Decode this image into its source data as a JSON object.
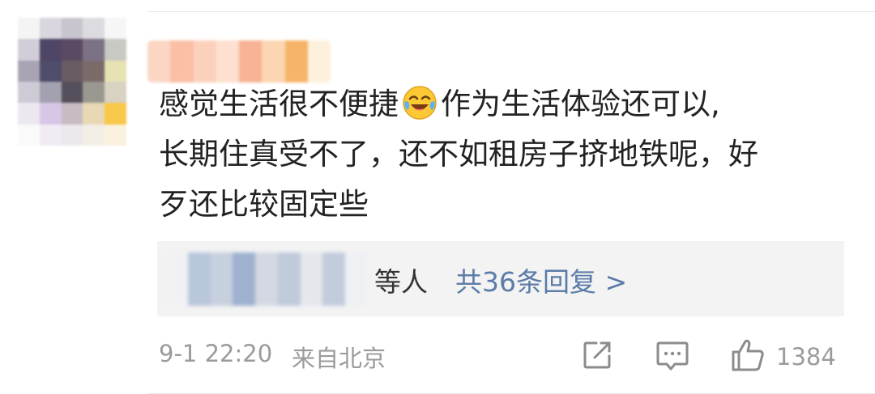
{
  "comment": {
    "line1_before_emoji": "感觉生活很不便捷",
    "emoji": "laughing-crying-face-icon",
    "line1_after_emoji": "作为生活体验还可以,",
    "line2": "长期住真受不了，还不如租房子挤地铁呢，好",
    "line3": "歹还比较固定些"
  },
  "replies": {
    "suffix": "等人",
    "count_label": "共36条回复 >"
  },
  "meta": {
    "time": "9-1 22:20",
    "source": "来自北京",
    "like_count": "1384"
  },
  "icons": {
    "share": "share-icon",
    "comment": "comment-icon",
    "like": "thumbs-up-icon"
  },
  "colors": {
    "link": "#5b7ca8",
    "meta_text": "#9b9b9b",
    "body_text": "#222222",
    "reply_bg": "#f3f3f3"
  }
}
